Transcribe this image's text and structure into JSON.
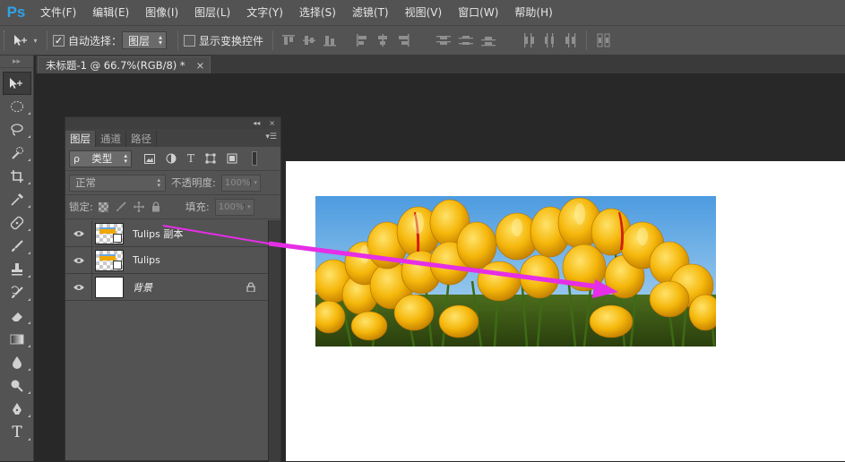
{
  "app": {
    "logo": "Ps"
  },
  "menu": [
    "文件(F)",
    "编辑(E)",
    "图像(I)",
    "图层(L)",
    "文字(Y)",
    "选择(S)",
    "滤镜(T)",
    "视图(V)",
    "窗口(W)",
    "帮助(H)"
  ],
  "options": {
    "auto_select_label": "自动选择：",
    "auto_select_checked": "✓",
    "auto_select_value": "图层",
    "show_transform_label": "显示变换控件"
  },
  "doc_tab": {
    "title": "未标题-1 @ 66.7%(RGB/8) *",
    "close": "×"
  },
  "layers_panel": {
    "collapse": "◂◂",
    "close": "×",
    "menu": "▾☰",
    "tabs": [
      "图层",
      "通道",
      "路径"
    ],
    "filter_value": "类型",
    "filter_prefix": "ρ",
    "blend_mode": "正常",
    "opacity_label": "不透明度:",
    "opacity_value": "100%",
    "lock_label": "锁定:",
    "fill_label": "填充:",
    "fill_value": "100%",
    "layers": [
      {
        "name": "Tulips 副本",
        "visible": true
      },
      {
        "name": "Tulips",
        "visible": true
      },
      {
        "name": "背景",
        "visible": true,
        "locked": true
      }
    ]
  },
  "colors": {
    "annotation_arrow": "#e62ee6",
    "ps_blue": "#2fa3e8",
    "ui_dark": "#535353"
  }
}
